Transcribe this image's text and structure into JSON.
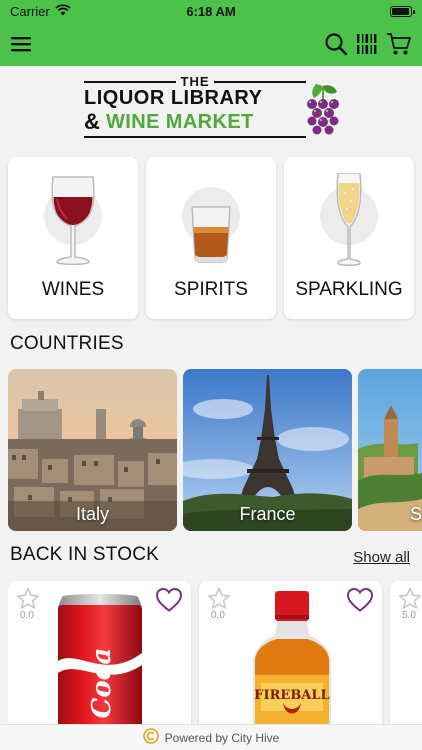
{
  "status_bar": {
    "carrier": "Carrier",
    "time": "6:18 AM",
    "battery_level": 0.95
  },
  "nav": {
    "menu_icon": "hamburger-menu-icon",
    "search_icon": "search-icon",
    "barcode_icon": "barcode-scan-icon",
    "cart_icon": "cart-icon",
    "bar_color": "#4cc24a"
  },
  "logo": {
    "the": "THE",
    "line1": "LIQUOR LIBRARY",
    "amp": "&",
    "line2": "WINE MARKET",
    "accent": "#4ea83a",
    "grape_color": "#7a2f82"
  },
  "categories": [
    {
      "label": "WINES",
      "icon": "wine-glass-icon"
    },
    {
      "label": "SPIRITS",
      "icon": "whiskey-glass-icon"
    },
    {
      "label": "SPARKLING",
      "icon": "champagne-flute-icon"
    }
  ],
  "countries_section": {
    "title": "COUNTRIES"
  },
  "countries": [
    {
      "label": "Italy"
    },
    {
      "label": "France"
    },
    {
      "label": "S"
    }
  ],
  "back_in_stock": {
    "title": "BACK IN STOCK",
    "show_all": "Show all"
  },
  "products": [
    {
      "rating": "0.0",
      "image": "coca-cola-can"
    },
    {
      "rating": "0.0",
      "image": "fireball-bottle"
    },
    {
      "rating": "5.0",
      "image": "partial-product"
    }
  ],
  "footer": {
    "text": "Powered by City Hive"
  },
  "colors": {
    "heart": "#7a2f82",
    "star_outline": "#c8c8c8"
  }
}
